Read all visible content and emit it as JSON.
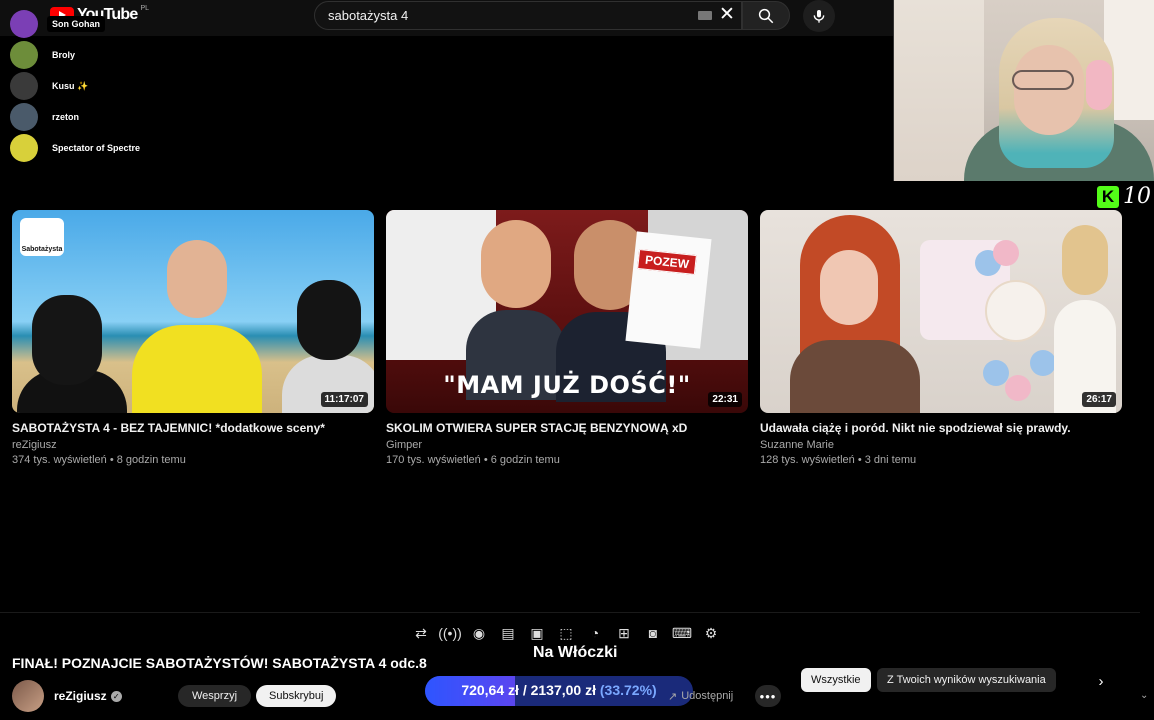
{
  "youtube": {
    "logo_text": "YouTube",
    "logo_region": "PL",
    "search_query": "sabotażysta 4"
  },
  "chat": {
    "users": [
      {
        "name": "Son Gohan",
        "avatar_color": "#7b3fb5"
      },
      {
        "name": "Broly",
        "avatar_color": "#6d8d3a"
      },
      {
        "name": "Kusu ✨",
        "avatar_color": "#3a3a3a"
      },
      {
        "name": "rzeton",
        "avatar_color": "#4a5a6a"
      },
      {
        "name": "Spectator of Spectre",
        "avatar_color": "#d8d03a"
      }
    ]
  },
  "kick": {
    "viewer_count": "10",
    "brand_color": "#53fc18"
  },
  "videos": [
    {
      "title": "SABOTAŻYSTA 4 - BEZ TAJEMNIC! *dodatkowe sceny*",
      "channel": "reZigiusz",
      "views": "374 tys. wyświetleń",
      "age": "8 godzin temu",
      "duration": "11:17:07",
      "thumb_brand": "Sabotażysta"
    },
    {
      "title": "SKOLIM OTWIERA SUPER STACJĘ BENZYNOWĄ xD",
      "channel": "Gimper",
      "views": "170 tys. wyświetleń",
      "age": "6 godzin temu",
      "duration": "22:31",
      "thumb_headline": "\"MAM JUŻ DOŚĆ!\"",
      "thumb_tag": "POZEW"
    },
    {
      "title": "Udawała ciążę i poród. Nikt nie spodziewał się prawdy.",
      "channel": "Suzanne Marie",
      "views": "128 tys. wyświetleń",
      "age": "3 dni temu",
      "duration": "26:17"
    }
  ],
  "player": {
    "control_icons": [
      "loop-icon",
      "broadcast-icon",
      "eye-icon",
      "clapperboard-icon",
      "pip-icon",
      "miniplayer-icon",
      "speed-icon",
      "add-icon",
      "screenshot-icon",
      "keyboard-icon",
      "settings-icon"
    ],
    "now_playing_title": "FINAŁ! POZNAJCIE SABOTAŻYSTÓW! SABOTAŻYSTA 4 odc.8",
    "overlay_label": "Na Włóczki",
    "channel_name": "reZigiusz",
    "support_label": "Wesprzyj",
    "subscribe_label": "Subskrybuj",
    "share_label": "Udostępnij",
    "more_label": "•••"
  },
  "goal": {
    "current": "720,64 zł",
    "separator": "/",
    "target": "2137,00 zł",
    "percent_label": "(33.72%)",
    "percent_value": 33.72
  },
  "chips": {
    "all_label": "Wszystkie",
    "from_search_label": "Z Twoich wyników wyszukiwania"
  }
}
